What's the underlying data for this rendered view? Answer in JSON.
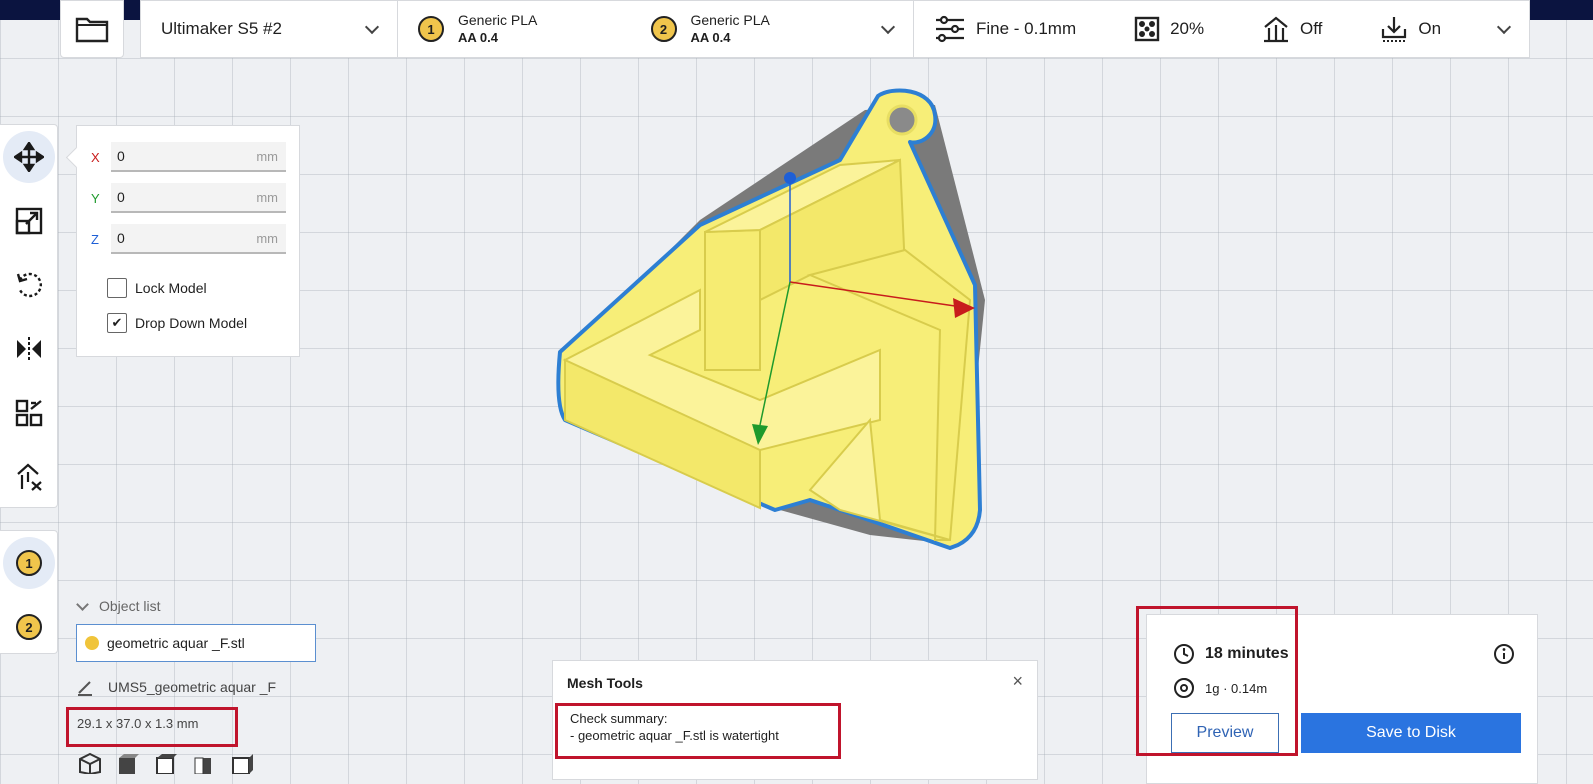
{
  "printer": {
    "name": "Ultimaker S5 #2"
  },
  "extruders": [
    {
      "number": "1",
      "material": "Generic PLA",
      "core": "AA 0.4"
    },
    {
      "number": "2",
      "material": "Generic PLA",
      "core": "AA 0.4"
    }
  ],
  "print_settings": {
    "profile": "Fine - 0.1mm",
    "infill": "20%",
    "support": "Off",
    "adhesion": "On"
  },
  "move_panel": {
    "x_label": "X",
    "x_value": "0",
    "y_label": "Y",
    "y_value": "0",
    "z_label": "Z",
    "z_value": "0",
    "unit": "mm",
    "lock_model": "Lock Model",
    "drop_down_model": "Drop Down Model",
    "drop_down_checked": true
  },
  "tool_extruders": [
    "1",
    "2"
  ],
  "object_list": {
    "header": "Object list",
    "selected_file": "geometric aquar _F.stl",
    "object_name": "UMS5_geometric aquar _F",
    "dimensions": "29.1 x 37.0 x 1.3 mm"
  },
  "mesh_tools": {
    "title": "Mesh Tools",
    "summary_title": "Check summary:",
    "summary_line": "- geometric aquar _F.stl is watertight",
    "close": "×"
  },
  "print_info": {
    "time": "18 minutes",
    "material_usage": "1g · 0.14m",
    "preview_label": "Preview",
    "save_label": "Save to Disk"
  },
  "colors": {
    "accent_blue": "#2a74e0",
    "highlight_red": "#c0142c",
    "model_yellow": "#f6ec6e",
    "extruder_yellow": "#f0c54c"
  }
}
